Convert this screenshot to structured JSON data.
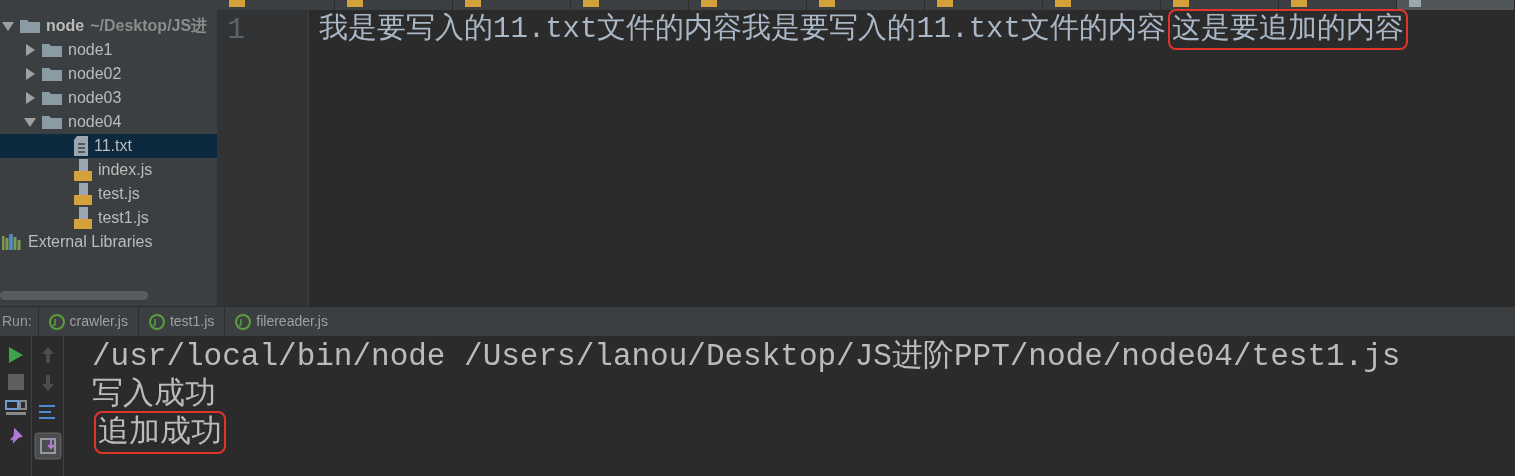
{
  "editor_tabs": [
    {
      "kind": "js",
      "selected": false
    },
    {
      "kind": "js",
      "selected": false
    },
    {
      "kind": "js",
      "selected": false
    },
    {
      "kind": "js",
      "selected": false
    },
    {
      "kind": "js",
      "selected": false
    },
    {
      "kind": "js",
      "selected": false
    },
    {
      "kind": "js",
      "selected": false
    },
    {
      "kind": "js",
      "selected": false
    },
    {
      "kind": "js",
      "selected": false
    },
    {
      "kind": "js",
      "selected": false
    },
    {
      "kind": "txt",
      "selected": true
    }
  ],
  "project_tree": [
    {
      "kind": "folder",
      "label": "node",
      "path": "~/Desktop/JS进",
      "expanded": true,
      "selected": false,
      "children": [
        {
          "kind": "folder",
          "label": "node1",
          "expanded": false,
          "selected": false
        },
        {
          "kind": "folder",
          "label": "node02",
          "expanded": false,
          "selected": false
        },
        {
          "kind": "folder",
          "label": "node03",
          "expanded": false,
          "selected": false
        },
        {
          "kind": "folder",
          "label": "node04",
          "expanded": true,
          "selected": false,
          "children": [
            {
              "kind": "txt",
              "label": "11.txt",
              "selected": true
            },
            {
              "kind": "js",
              "label": "index.js",
              "selected": false
            },
            {
              "kind": "js",
              "label": "test.js",
              "selected": false
            },
            {
              "kind": "js",
              "label": "test1.js",
              "selected": false
            }
          ]
        }
      ]
    },
    {
      "kind": "library",
      "label": "External Libraries",
      "selected": false
    }
  ],
  "editor": {
    "lines": [
      {
        "number": "1",
        "segments": [
          {
            "text": "我是要写入的11.txt文件的内容我是要写入的11.txt文件的内容",
            "highlighted": false
          },
          {
            "text": "这是要追加的内容",
            "highlighted": true
          }
        ]
      }
    ]
  },
  "run_panel": {
    "label": "Run:",
    "tabs": [
      {
        "label": "crawler.js"
      },
      {
        "label": "test1.js"
      },
      {
        "label": "filereader.js"
      }
    ],
    "console_lines": [
      {
        "text": "/usr/local/bin/node /Users/lanou/Desktop/JS进阶PPT/node/node04/test1.js",
        "highlighted": false
      },
      {
        "text": "写入成功",
        "highlighted": false
      },
      {
        "text": "追加成功",
        "highlighted": true
      }
    ]
  }
}
